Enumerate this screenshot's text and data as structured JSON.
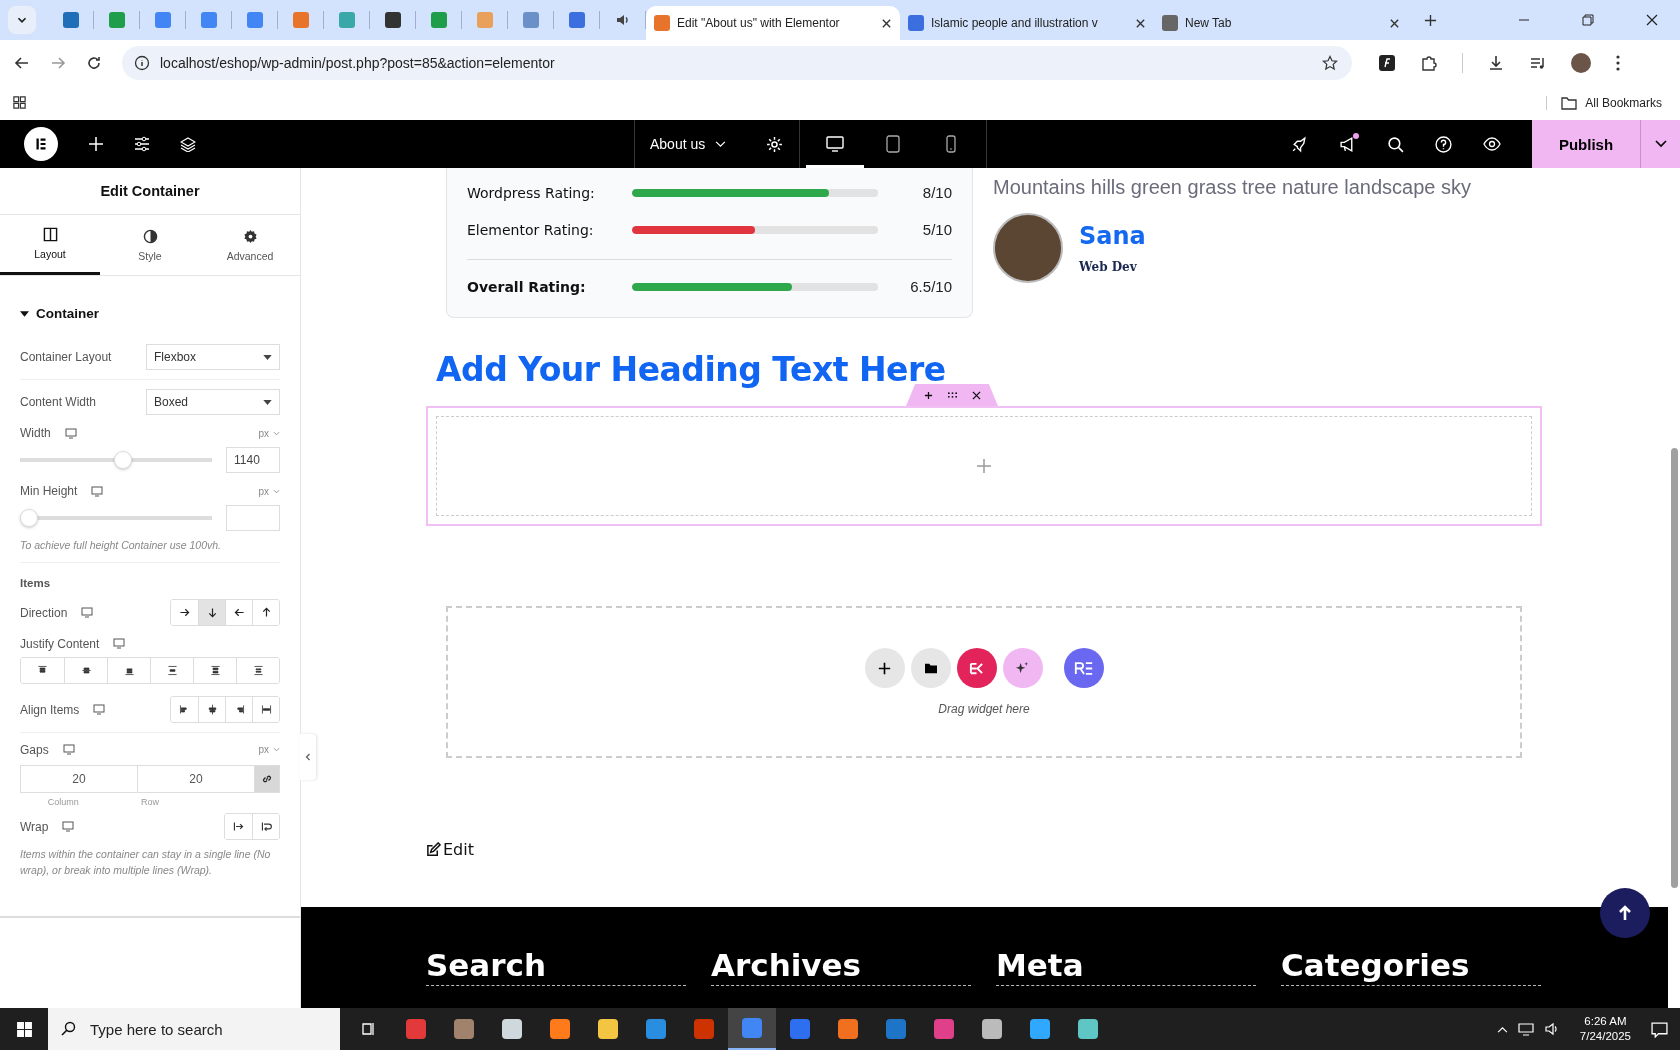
{
  "browser": {
    "tabs": [
      {
        "kind": "icon",
        "color": "#1e6fb8",
        "selected": false
      },
      {
        "kind": "icon",
        "color": "#1e9e4a",
        "selected": false
      },
      {
        "kind": "icon",
        "color": "#4285f4",
        "selected": false
      },
      {
        "kind": "icon",
        "color": "#4285f4",
        "selected": false
      },
      {
        "kind": "icon",
        "color": "#4285f4",
        "selected": false
      },
      {
        "kind": "icon",
        "color": "#e8732a",
        "selected": false
      },
      {
        "kind": "icon",
        "color": "#3aa8a8",
        "selected": false
      },
      {
        "kind": "icon",
        "color": "#333333",
        "selected": false
      },
      {
        "kind": "icon",
        "color": "#1e9e4a",
        "selected": false
      },
      {
        "kind": "icon",
        "color": "#e8a05c",
        "selected": false
      },
      {
        "kind": "icon",
        "color": "#6b8fc7",
        "selected": false
      },
      {
        "kind": "icon",
        "color": "#3b6fe0",
        "selected": false
      },
      {
        "kind": "audio",
        "selected": false
      },
      {
        "kind": "text",
        "title": "Edit \"About us\" with Elementor",
        "color": "#e8732a",
        "selected": true
      },
      {
        "kind": "text",
        "title": "Islamic people and illustration v",
        "color": "#3b6fe0",
        "selected": false
      },
      {
        "kind": "text",
        "title": "New Tab",
        "color": "#666666",
        "selected": false
      }
    ],
    "url": "localhost/eshop/wp-admin/post.php?post=85&action=elementor",
    "bookmarks": "All Bookmarks"
  },
  "editor_bar": {
    "page": "About us",
    "devices": [
      {
        "kind": "desktop",
        "selected": true
      },
      {
        "kind": "tablet",
        "selected": false
      },
      {
        "kind": "mobile",
        "selected": false
      }
    ],
    "publish": "Publish"
  },
  "panel": {
    "title": "Edit Container",
    "tabs": [
      {
        "kind": "layout",
        "label": "Layout",
        "selected": true
      },
      {
        "kind": "style",
        "label": "Style",
        "selected": false
      },
      {
        "kind": "advanced",
        "label": "Advanced",
        "selected": false
      }
    ],
    "section": "Container",
    "container_layout": {
      "label": "Container Layout",
      "value": "Flexbox"
    },
    "content_width": {
      "label": "Content Width",
      "value": "Boxed"
    },
    "width": {
      "label": "Width",
      "unit": "px",
      "level": 0.54,
      "value": "1140"
    },
    "min_height": {
      "label": "Min Height",
      "unit": "px",
      "level": 0,
      "hint": "To achieve full height Container use 100vh."
    },
    "items_heading": "Items",
    "direction": {
      "label": "Direction",
      "options": [
        {
          "kind": "right",
          "selected": false
        },
        {
          "kind": "down",
          "selected": true
        },
        {
          "kind": "left",
          "selected": false
        },
        {
          "kind": "up",
          "selected": false
        }
      ]
    },
    "justify": {
      "label": "Justify Content",
      "options": [
        {
          "kind": "start"
        },
        {
          "kind": "center"
        },
        {
          "kind": "end"
        },
        {
          "kind": "between"
        },
        {
          "kind": "around"
        },
        {
          "kind": "evenly"
        }
      ]
    },
    "align": {
      "label": "Align Items",
      "options": [
        {
          "kind": "start"
        },
        {
          "kind": "center"
        },
        {
          "kind": "end"
        },
        {
          "kind": "stretch"
        }
      ]
    },
    "gaps": {
      "label": "Gaps",
      "unit": "px",
      "column": "20",
      "row": "20",
      "column_label": "Column",
      "row_label": "Row",
      "linked": true
    },
    "wrap": {
      "label": "Wrap",
      "options": [
        {
          "kind": "nowrap"
        },
        {
          "kind": "wrap"
        }
      ],
      "hint": "Items within the container can stay in a single line (No wrap), or break into multiple lines (Wrap)."
    }
  },
  "canvas": {
    "ratings": [
      {
        "label": "Wordpress Rating:",
        "level": 0.8,
        "score": "8/10",
        "color": "#2ea84a"
      },
      {
        "label": "Elementor Rating:",
        "level": 0.5,
        "score": "5/10",
        "color": "#e0343f"
      }
    ],
    "overall": {
      "label": "Overall Rating:",
      "level": 0.65,
      "score": "6.5/10",
      "color": "#2ea84a"
    },
    "caption": "Mountains hills green grass tree nature landscape sky",
    "author": {
      "name": "Sana",
      "role": "Web Dev"
    },
    "heading": "Add Your Heading Text Here",
    "drop_hint": "Drag widget here",
    "edit_link": "Edit",
    "footer": [
      "Search",
      "Archives",
      "Meta",
      "Categories"
    ]
  },
  "taskbar": {
    "search_placeholder": "Type here to search",
    "time": "6:26 AM",
    "date": "7/24/2025",
    "apps": [
      {
        "color": "#e23a3a",
        "selected": false
      },
      {
        "color": "#a0826d",
        "selected": false
      },
      {
        "color": "#cfd8dc",
        "selected": false
      },
      {
        "color": "#ff7a1a",
        "selected": false
      },
      {
        "color": "#f4c542",
        "selected": false
      },
      {
        "color": "#2a8ee0",
        "selected": false
      },
      {
        "color": "#cc3300",
        "selected": false
      },
      {
        "color": "#4285f4",
        "selected": true
      },
      {
        "color": "#2d6ff0",
        "selected": false
      },
      {
        "color": "#f07020",
        "selected": false
      },
      {
        "color": "#1e74c7",
        "selected": false
      },
      {
        "color": "#e0408a",
        "selected": false
      },
      {
        "color": "#bbbbbb",
        "selected": false
      },
      {
        "color": "#31a8ff",
        "selected": false
      },
      {
        "color": "#5fc5c5",
        "selected": false
      }
    ]
  }
}
